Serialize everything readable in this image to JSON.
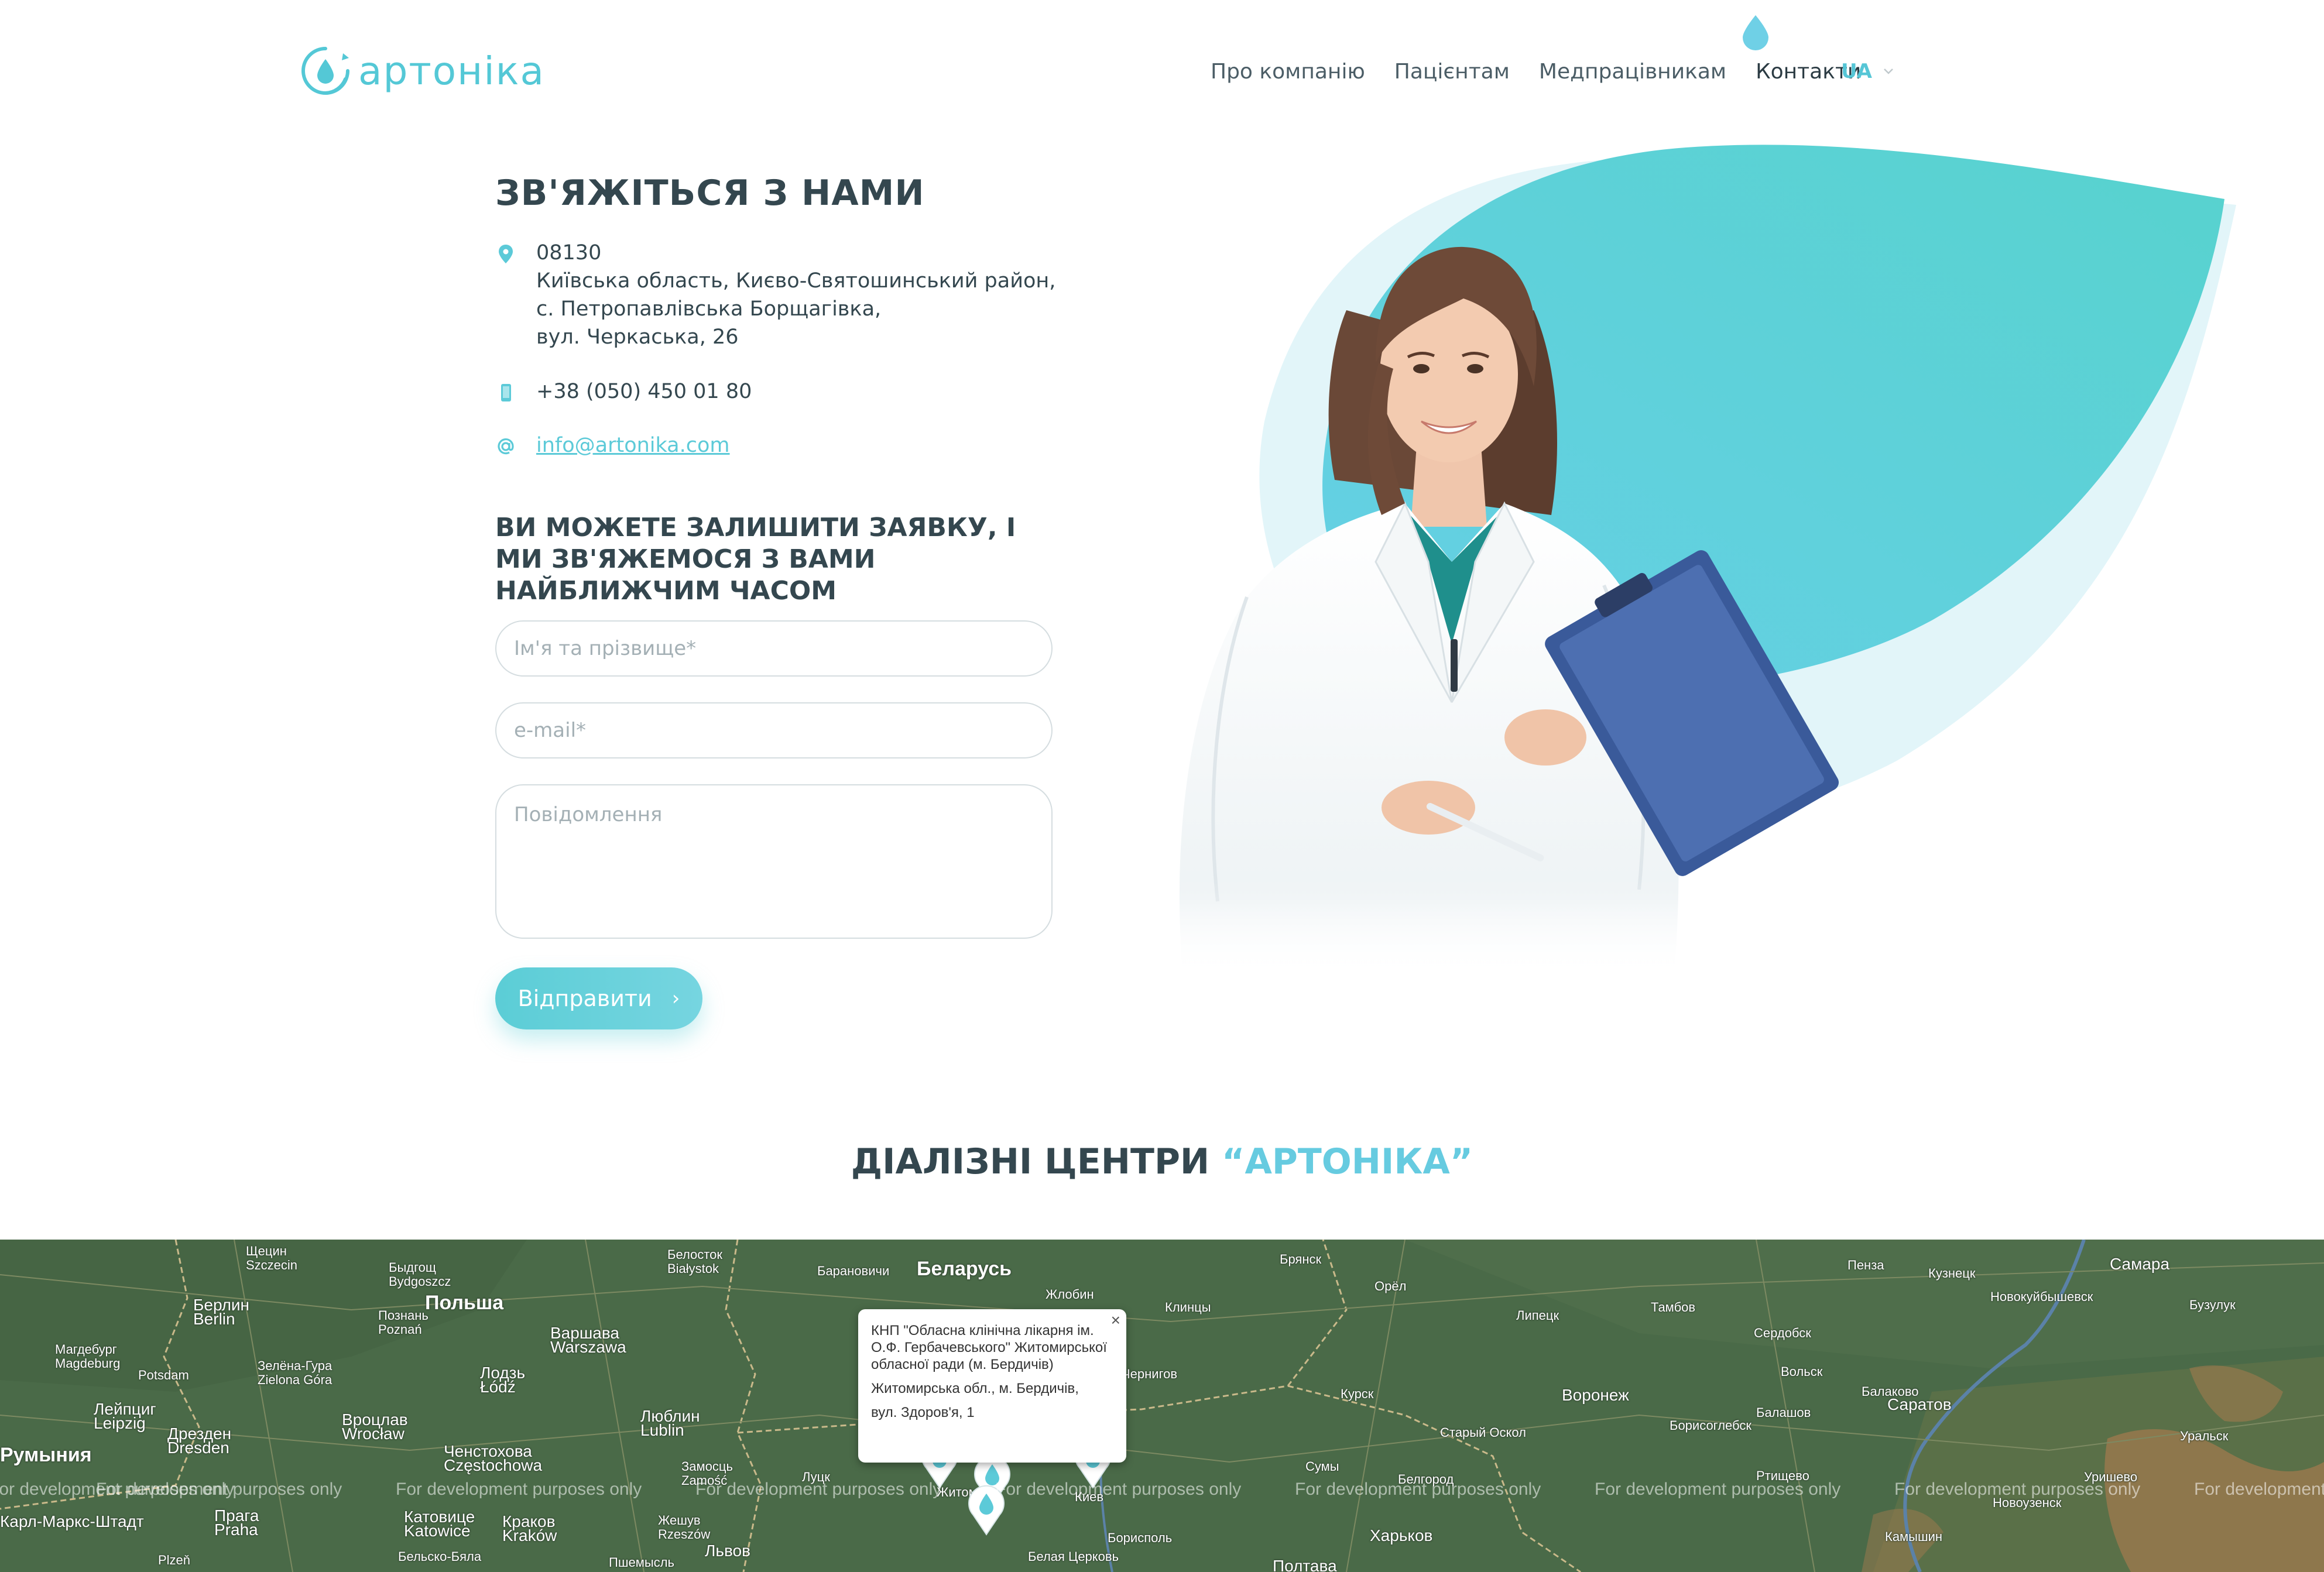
{
  "header": {
    "logo_text": "артоніка",
    "nav": [
      {
        "label": "Про компанію",
        "active": false
      },
      {
        "label": "Пацієнтам",
        "active": false
      },
      {
        "label": "Медпрацівникам",
        "active": false
      },
      {
        "label": "Контакти",
        "active": true
      }
    ],
    "language": "UA",
    "accent_color": "#56c6d6"
  },
  "contact": {
    "title": "ЗВ'ЯЖІТЬСЯ З НАМИ",
    "address_lines": [
      "08130",
      "Київська область, Києво-Святошинський район,",
      "с. Петропавлівська Борщагівка,",
      "вул. Черкаська, 26"
    ],
    "phone": "+38 (050) 450 01 80",
    "email": "info@artonika.com",
    "icons": [
      "location-pin-icon",
      "phone-icon",
      "at-sign-icon"
    ]
  },
  "form": {
    "title": "ВИ МОЖЕТЕ ЗАЛИШИТИ ЗАЯВКУ, І МИ ЗВ'ЯЖЕМОСЯ З ВАМИ НАЙБЛИЖЧИМ ЧАСОМ",
    "name_placeholder": "Ім'я та прізвище*",
    "email_placeholder": "e-mail*",
    "message_placeholder": "Повідомлення",
    "submit_label": "Відправити",
    "submit_arrow": "›"
  },
  "centers": {
    "title_main": "ДІАЛІЗНІ ЦЕНТРИ ",
    "title_accent": "“АРТОНІКА”"
  },
  "map": {
    "watermark": "For development purposes only",
    "popup": {
      "name": "КНП \"Обласна клінічна лікарня ім. О.Ф. Гербачевського\" Житомирської обласної ради (м. Бердичів)",
      "address_1": "Житомирська обл., м. Бердичів,",
      "address_2": "вул. Здоров'я, 1",
      "close": "×"
    },
    "cities": [
      {
        "name": "Щецин",
        "sub": "Szczecin"
      },
      {
        "name": "Быдгощ",
        "sub": "Bydgoszcz"
      },
      {
        "name": "Белосток",
        "sub": "Białystok"
      },
      {
        "name": "Барановичи"
      },
      {
        "name": "Беларусь",
        "big": true
      },
      {
        "name": "Жлобин"
      },
      {
        "name": "Брянск"
      },
      {
        "name": "Пенза"
      },
      {
        "name": "Кузнецк"
      },
      {
        "name": "Самара"
      },
      {
        "name": "Берлин",
        "sub": "Berlin"
      },
      {
        "name": "Познань",
        "sub": "Poznań"
      },
      {
        "name": "Польша",
        "big": true
      },
      {
        "name": "Клинцы"
      },
      {
        "name": "Орёл"
      },
      {
        "name": "Липецк"
      },
      {
        "name": "Тамбов"
      },
      {
        "name": "Новокуйбышевск"
      },
      {
        "name": "Бузулук"
      },
      {
        "name": "Магдебург",
        "sub": "Magdeburg"
      },
      {
        "name": "Potsdam"
      },
      {
        "name": "Варшава",
        "sub": "Warszawa"
      },
      {
        "name": "Зелёна-Гура",
        "sub": "Zielona Góra"
      },
      {
        "name": "Лодзь",
        "sub": "Łódź"
      },
      {
        "name": "Курск"
      },
      {
        "name": "Сердобск"
      },
      {
        "name": "Вольск"
      },
      {
        "name": "Балаково"
      },
      {
        "name": "Лейпциг",
        "sub": "Leipzig"
      },
      {
        "name": "Дрезден",
        "sub": "Dresden"
      },
      {
        "name": "Вроцлав",
        "sub": "Wrocław"
      },
      {
        "name": "Ченстохова",
        "sub": "Częstochowa"
      },
      {
        "name": "Люблин",
        "sub": "Lublin"
      },
      {
        "name": "Замосць",
        "sub": "Zamość"
      },
      {
        "name": "Луцк"
      },
      {
        "name": "Житомир"
      },
      {
        "name": "Чернигов"
      },
      {
        "name": "Сумы"
      },
      {
        "name": "Белгород"
      },
      {
        "name": "Старый Оскол"
      },
      {
        "name": "Воронеж",
        "mid": true
      },
      {
        "name": "Борисоглебск"
      },
      {
        "name": "Балашов"
      },
      {
        "name": "Саратов",
        "mid": true
      },
      {
        "name": "Уральск"
      },
      {
        "name": "Ртищево"
      },
      {
        "name": "Уришево"
      },
      {
        "name": "Румыния",
        "big": true
      },
      {
        "name": "Катовице",
        "sub": "Katowice"
      },
      {
        "name": "Краков",
        "sub": "Kraków"
      },
      {
        "name": "Прага",
        "sub": "Praha"
      },
      {
        "name": "Жешув",
        "sub": "Rzeszów"
      },
      {
        "name": "Киев"
      },
      {
        "name": "Борисполь"
      },
      {
        "name": "Харьков",
        "mid": true
      },
      {
        "name": "Камышин"
      },
      {
        "name": "Новоузенск"
      },
      {
        "name": "Карл-Маркс-Штадт"
      },
      {
        "name": "Львов",
        "mid": true
      },
      {
        "name": "Белая Церковь"
      },
      {
        "name": "Полтава"
      },
      {
        "name": "Plzeň"
      },
      {
        "name": "Пшемысль"
      },
      {
        "name": "Бельско-Бяла"
      }
    ]
  }
}
